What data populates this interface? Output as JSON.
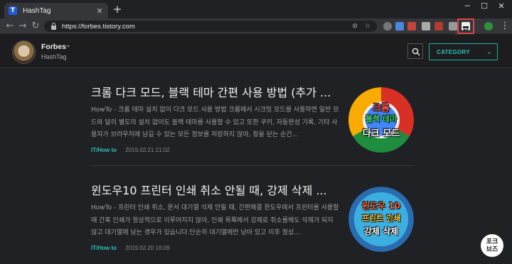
{
  "browser": {
    "tab_title": "HashTag",
    "tab_favicon_letter": "T",
    "url": "https://forbes.tistory.com"
  },
  "blog": {
    "name": "Forbes",
    "subtitle": "HashTag",
    "category_label": "CATEGORY"
  },
  "posts": [
    {
      "title": "크롬 다크 모드, 블랙 테마 간편 사용 방법 (추가 ...",
      "excerpt": "HowTo - 크롬 테마 설치 없이 다크 모드 사용 방법 크롬에서 시크릿 모드를 사용하면 일반 모드와 달리 별도의 설치 없이도 블랙 테마를 사용할 수 있고 또한 쿠키, 자동완성 기록, 기타 사용자가 브라우저에 남길 수 있는 모든 정보를 저장하지 않아, 창을 닫는 순간...",
      "category": "IT/How to",
      "date": "2019.02.21 21:02",
      "thumb_lines": [
        "크롬",
        "블랙 테마",
        "다크 모드"
      ]
    },
    {
      "title": "윈도우10 프린터 인쇄 취소 안될 때, 강제 삭제 ...",
      "excerpt": "HowTo - 프린터 인쇄 취소, 문서 대기열 삭제 안될 때, 간편해결 윈도우에서 프린터를 사용할 때 간혹 인쇄가 정상적으로 이루어지지 않아, 인쇄 목록에서 강제로 취소를해도 삭제가 되지 않고 대기열에 남는 경우가 있습니다.단순히 대기열에만 남아 있고 이후 정상...",
      "category": "IT/How to",
      "date": "2019.02.20 16:09",
      "thumb_lines": [
        "윈도우 10",
        "프린트 인쇄",
        "강제 삭제"
      ]
    }
  ],
  "badge": {
    "line1": "포크",
    "line2": "브즈"
  },
  "colors": {
    "accent": "#2cc3b5",
    "background": "#202124",
    "highlight": "#e0463f"
  }
}
